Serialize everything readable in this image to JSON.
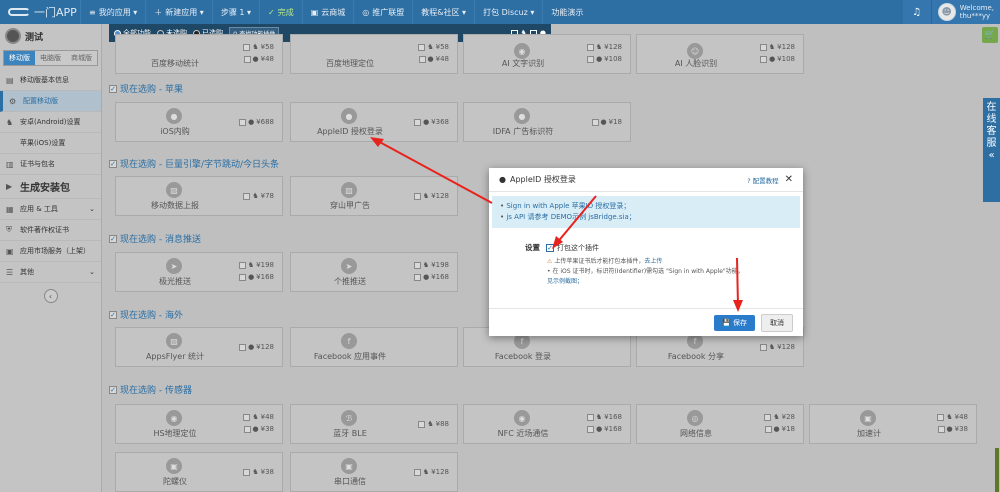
{
  "topbar": {
    "logo": "一门APP",
    "nav": [
      {
        "icon": "≡",
        "label": "我的应用 ▾"
      },
      {
        "icon": "＋",
        "label": "新建应用 ▾"
      },
      {
        "icon": "",
        "label": "步骤 1 ▾"
      },
      {
        "icon": "✓",
        "label": "完成"
      },
      {
        "icon": "▣",
        "label": "云商城"
      },
      {
        "icon": "◎",
        "label": "推广联盟"
      },
      {
        "icon": "",
        "label": "教程&社区 ▾"
      },
      {
        "icon": "",
        "label": "打包 Discuz ▾"
      },
      {
        "icon": "",
        "label": "功能演示"
      }
    ],
    "welcome": "Welcome,",
    "username": "thu***yy"
  },
  "sidebar": {
    "project": "测试",
    "tabs": [
      "移动版",
      "电脑版",
      "商城版"
    ],
    "items": [
      {
        "icon": "▤",
        "label": "移动版基本信息"
      },
      {
        "icon": "⚙",
        "label": "配置移动版"
      },
      {
        "icon": "♞",
        "label": "安卓(Android)设置"
      },
      {
        "icon": "",
        "label": "苹果(iOS)设置"
      },
      {
        "icon": "▥",
        "label": "证书与包名"
      },
      {
        "icon": "▶",
        "label": "生成安装包"
      },
      {
        "icon": "▦",
        "label": "应用 & 工具"
      },
      {
        "icon": "⛨",
        "label": "软件著作权证书"
      },
      {
        "icon": "▣",
        "label": "应用市场服务（上架）"
      },
      {
        "icon": "☰",
        "label": "其他"
      }
    ]
  },
  "filter": {
    "all": "全部功能",
    "unbought": "未选购",
    "bought": "已选购",
    "search": "查找功能插件"
  },
  "sections": {
    "apple": "现在选购 -  苹果",
    "engine": "现在选购 - 巨量引擎/字节跳动/今日头条",
    "push": "现在选购 - 消息推送",
    "overseas": "现在选购 - 海外",
    "sensor": "现在选购 - 传感器"
  },
  "cards": [
    {
      "name": "百度移动统计",
      "p1": "¥58",
      "p2": "¥48"
    },
    {
      "name": "百度地理定位",
      "p1": "¥58",
      "p2": "¥48"
    },
    {
      "name": "AI 文字识别",
      "p1": "¥128",
      "p2": "¥108"
    },
    {
      "name": "AI 人脸识别",
      "p1": "¥128",
      "p2": "¥108"
    },
    {
      "name": "iOS内购",
      "p1": "¥688",
      "p2": ""
    },
    {
      "name": "AppleID 授权登录",
      "p1": "¥368",
      "p2": ""
    },
    {
      "name": "IDFA 广告标识符",
      "p1": "¥18",
      "p2": ""
    },
    {
      "name": "移动数据上报",
      "p1": "¥78",
      "p2": ""
    },
    {
      "name": "穿山甲广告",
      "p1": "¥128",
      "p2": ""
    },
    {
      "name": "极光推送",
      "p1": "¥198",
      "p2": "¥168"
    },
    {
      "name": "个推推送",
      "p1": "¥198",
      "p2": "¥168"
    },
    {
      "name": "AppsFlyer 统计",
      "p1": "¥128",
      "p2": ""
    },
    {
      "name": "Facebook 应用事件",
      "p1": "",
      "p2": ""
    },
    {
      "name": "Facebook 登录",
      "p1": "",
      "p2": ""
    },
    {
      "name": "Facebook 分享",
      "p1": "¥128",
      "p2": ""
    },
    {
      "name": "HS地理定位",
      "p1": "¥48",
      "p2": "¥38"
    },
    {
      "name": "蓝牙 BLE",
      "p1": "¥88",
      "p2": ""
    },
    {
      "name": "NFC 近场通信",
      "p1": "¥168",
      "p2": "¥168"
    },
    {
      "name": "网络信息",
      "p1": "¥28",
      "p2": "¥18"
    },
    {
      "name": "加速计",
      "p1": "¥48",
      "p2": "¥38"
    },
    {
      "name": "陀螺仪",
      "p1": "¥38",
      "p2": ""
    },
    {
      "name": "串口通信",
      "p1": "¥128",
      "p2": ""
    }
  ],
  "right_tab": "在线客服",
  "modal": {
    "title": "AppleID 授权登录",
    "help": "? 配置教程",
    "close": "✕",
    "info1": "Sign in with Apple 苹果ID 授权登录；",
    "info2": "js API 请参考 DEMO示例 jsBridge.sia；",
    "label": "设置",
    "check": "打包这个插件",
    "note1": "上传苹果证书后才能打包本插件，",
    "note1_link": "去上传",
    "note2": "• 在 iOS 证书时，标识符(Identifier)需勾选 \"Sign in with Apple\"功能，",
    "note3": "见示例截图；",
    "save": "保存",
    "cancel": "取消"
  }
}
